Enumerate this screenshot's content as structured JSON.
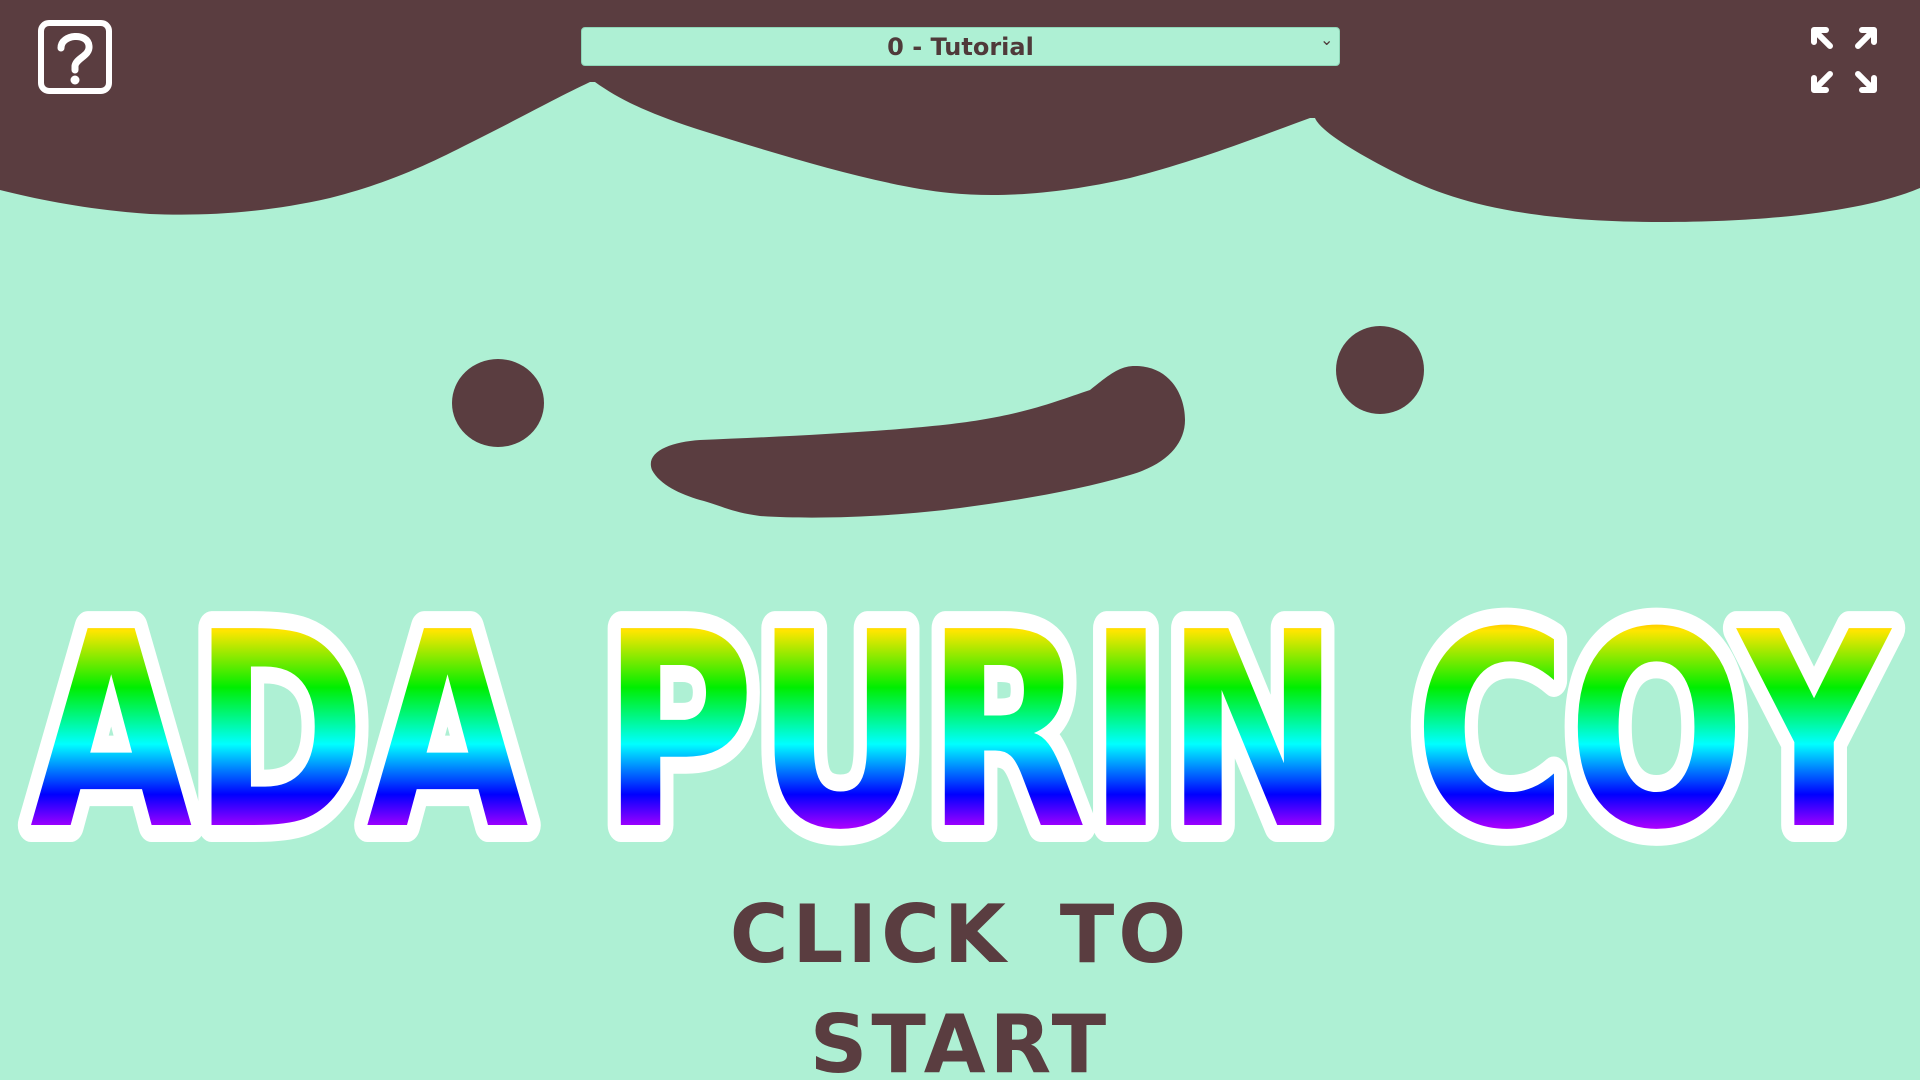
{
  "game": {
    "title": "ADA PURIN COY",
    "start_prompt": "CLICK TO START"
  },
  "level_select": {
    "selected": "0 - Tutorial",
    "options": [
      "0 - Tutorial"
    ]
  },
  "controls": {
    "help_icon": "question-mark-icon",
    "fullscreen_icon": "fullscreen-expand-icon"
  },
  "colors": {
    "background": "#aef0d4",
    "face_features": "#5a3d40",
    "title_outline": "#ffffff",
    "title_gradient": [
      "#ff0000",
      "#ffe600",
      "#00ee00",
      "#00ffff",
      "#0000ff",
      "#ff00ff",
      "#ff0000"
    ]
  }
}
